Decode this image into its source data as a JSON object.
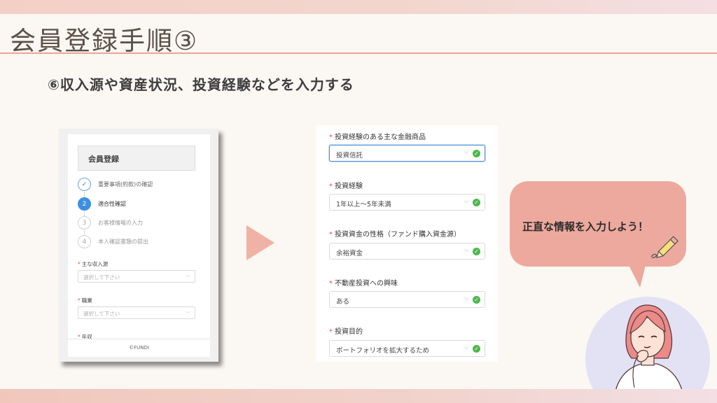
{
  "page": {
    "title": "会員登録手順③",
    "subtitle": "⑥収入源や資産状況、投資経験などを入力する"
  },
  "left_form": {
    "header": "会員登録",
    "steps": [
      {
        "number": "✓",
        "label": "重要事項(約款)の確認",
        "state": "done"
      },
      {
        "number": "2",
        "label": "適合性確認",
        "state": "active"
      },
      {
        "number": "3",
        "label": "お客様情報の入力",
        "state": "pending"
      },
      {
        "number": "4",
        "label": "本人確認書類の提出",
        "state": "pending"
      }
    ],
    "fields": [
      {
        "label": "主な収入源",
        "placeholder": "選択して下さい"
      },
      {
        "label": "職業",
        "placeholder": "選択して下さい"
      },
      {
        "label": "年収",
        "placeholder": ""
      }
    ],
    "required_mark": "*",
    "footer": "©FUNDI"
  },
  "right_form": {
    "required_mark": "*",
    "fields": [
      {
        "label": "投資経験のある主な金融商品",
        "value": "投資信託",
        "focused": true
      },
      {
        "label": "投資経験",
        "value": "1年以上〜5年未満",
        "focused": false
      },
      {
        "label": "投資資金の性格（ファンド購入資金源）",
        "value": "余裕資金",
        "focused": false
      },
      {
        "label": "不動産投資への興味",
        "value": "ある",
        "focused": false
      },
      {
        "label": "投資目的",
        "value": "ポートフォリオを拡大するため",
        "focused": false
      }
    ]
  },
  "bubble": {
    "text": "正直な情報を入力しよう！"
  },
  "icons": {
    "chevron": "chevron-down-icon",
    "check": "check-circle-icon",
    "arrow": "play-arrow-icon",
    "pencil": "pencil-icon"
  },
  "colors": {
    "accent": "#e6a696",
    "bubble": "#eda99d",
    "arrow": "#efb2a4",
    "step_active": "#3d8fe3",
    "valid_check": "#4cb84c",
    "avatar_bg": "#e2e2f4"
  }
}
